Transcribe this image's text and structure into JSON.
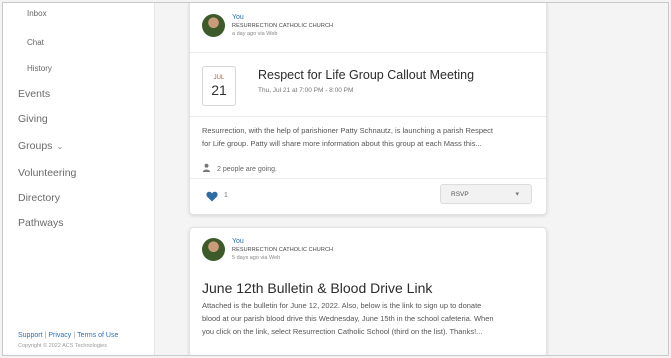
{
  "sidebar": {
    "sub_items": [
      {
        "label": "Inbox"
      },
      {
        "label": "Chat"
      },
      {
        "label": "History"
      }
    ],
    "items": [
      {
        "label": "Events"
      },
      {
        "label": "Giving"
      },
      {
        "label": "Groups"
      },
      {
        "label": "Volunteering"
      },
      {
        "label": "Directory"
      },
      {
        "label": "Pathways"
      }
    ],
    "footer": {
      "support": "Support",
      "privacy": "Privacy",
      "terms": "Terms of Use",
      "copyright": "Copyright © 2022 ACS Technologies"
    }
  },
  "posts": [
    {
      "author": "You",
      "org": "RESURRECTION CATHOLIC CHURCH",
      "meta": "a day ago via Web",
      "event": {
        "month": "JUL",
        "day": "21",
        "title": "Respect for Life Group Callout Meeting",
        "time": "Thu, Jul 21 at 7:00 PM - 8:00 PM"
      },
      "description_line1": "Resurrection, with the help of parishioner Patty Schnautz, is launching a parish Respect",
      "description_line2": "for Life group. Patty will share more information about this group at each Mass this...",
      "going": "2 people are going.",
      "likes": "1",
      "rsvp_label": "RSVP"
    },
    {
      "author": "You",
      "org": "RESURRECTION CATHOLIC CHURCH",
      "meta": "5 days ago via Web",
      "title": "June 12th Bulletin & Blood Drive Link",
      "description_line1": "Attached is the bulletin for June 12, 2022. Also, below is the link to sign up to donate",
      "description_line2": "blood at our parish blood drive this Wednesday, June 15th in the school cafeteria. When",
      "description_line3": "you click on the link, select Resurrection Catholic School (third on the list). Thanks!..."
    }
  ],
  "colors": {
    "link": "#2a6ebb",
    "heart": "#2e6da4",
    "month": "#b05a3c"
  }
}
